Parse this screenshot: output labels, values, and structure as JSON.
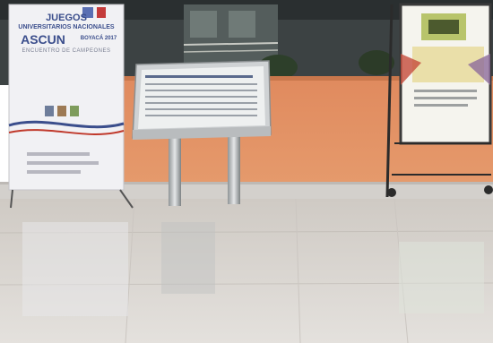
{
  "scene": {
    "banner_left": {
      "line1": "JUEGOS",
      "line2": "UNIVERSITARIOS NACIONALES",
      "line3": "ASCUN",
      "line4": "BOYACÁ 2017",
      "line5": "ENCUENTRO DE CAMPEONES"
    },
    "colors": {
      "wall": "#e5885a",
      "floor": "#d8d4cf",
      "banner": "#f0f0f4",
      "accent": "#3b4e8c"
    }
  }
}
